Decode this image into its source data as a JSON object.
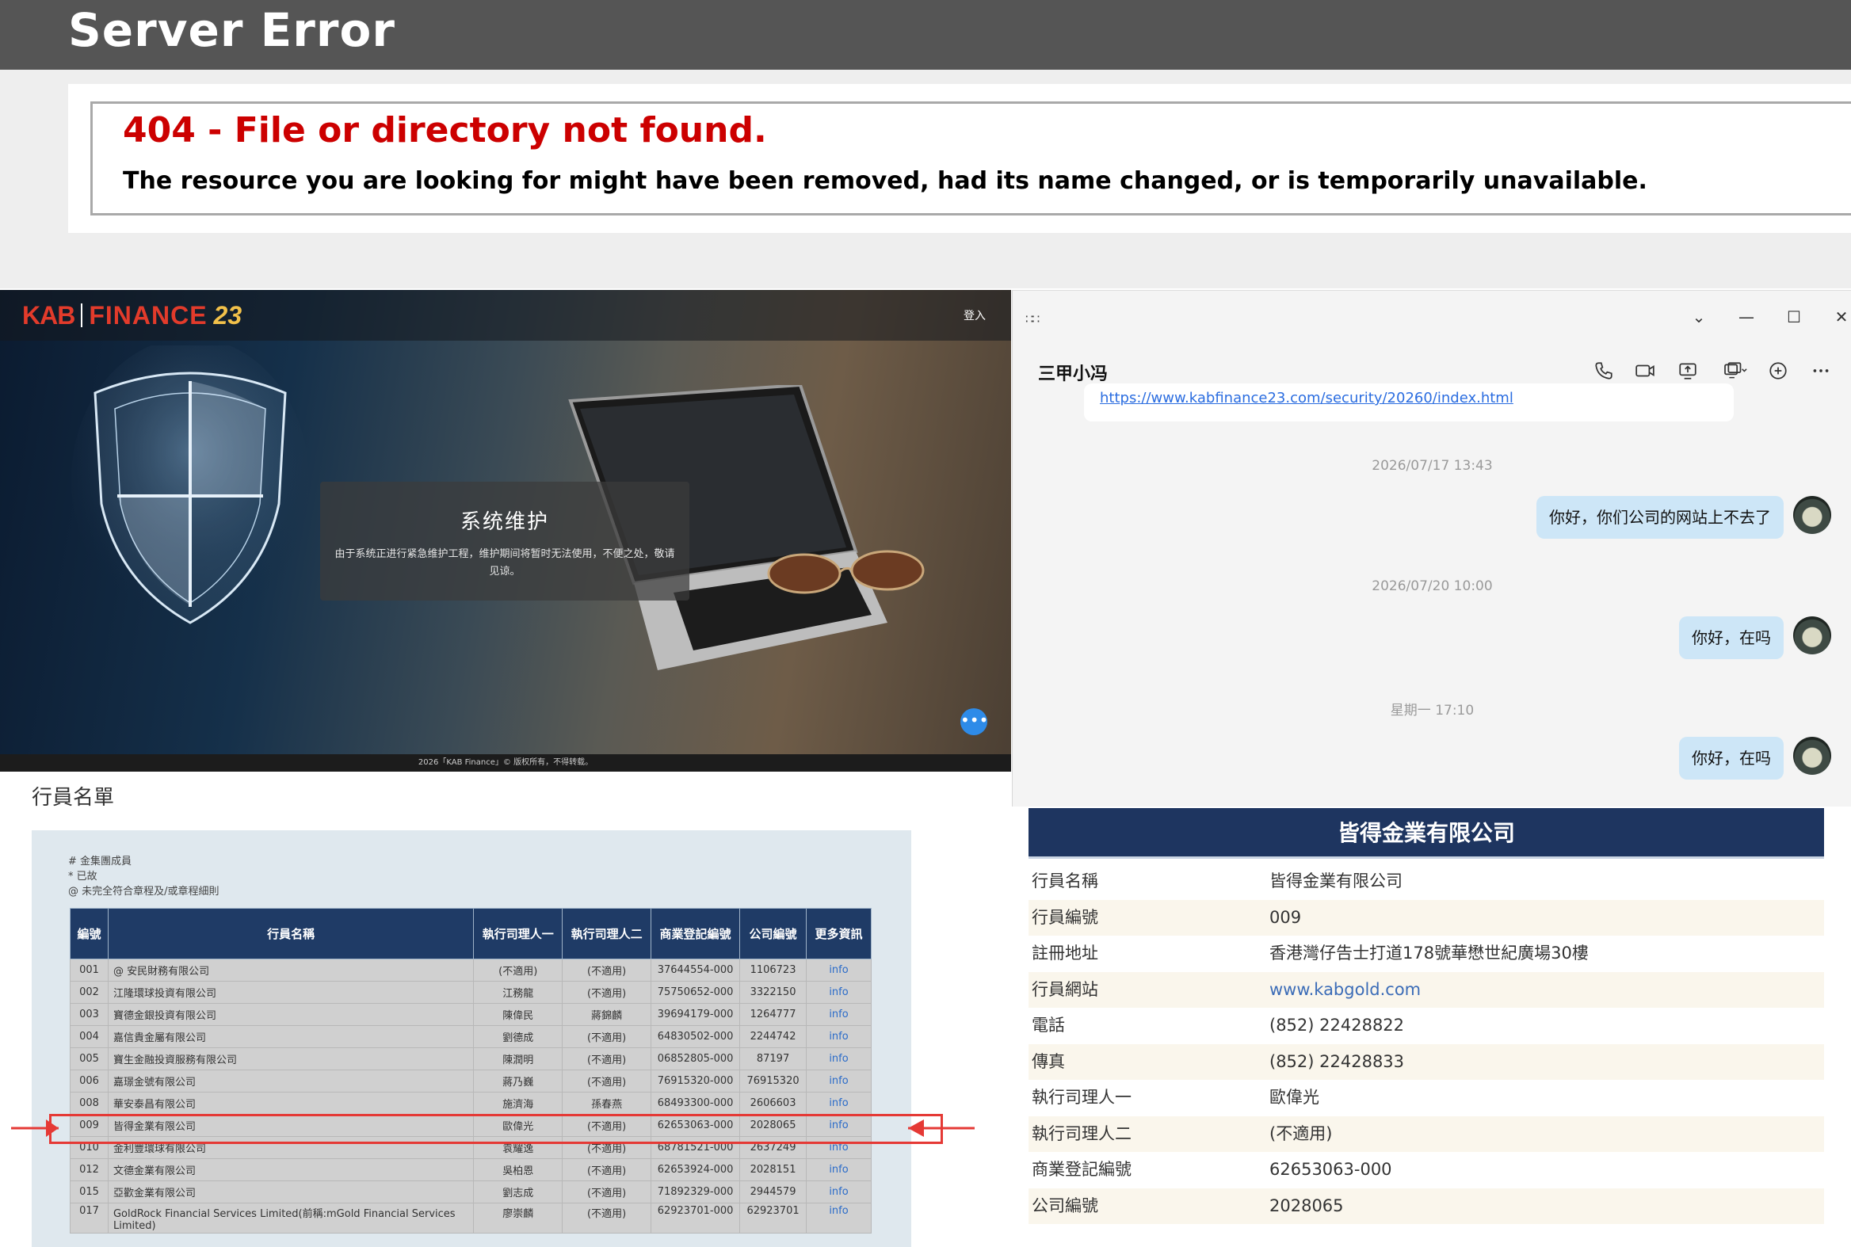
{
  "server_error": {
    "title": "Server Error",
    "code_line": "404 - File or directory not found.",
    "message": "The resource you are looking for might have been removed, had its name changed, or is temporarily unavailable."
  },
  "kab_site": {
    "logo_left": "KAB",
    "logo_mid": "FINANCE",
    "logo_num": "23",
    "login": "登入",
    "maintenance_title": "系统维护",
    "maintenance_text": "由于系统正进行紧急维护工程，维护期间将暂时无法使用，不便之处，敬请见谅。",
    "footer": "2026「KAB Finance」© 版权所有，不得转载。"
  },
  "chat": {
    "contact_name": "三甲小冯",
    "link_text": "https://www.kabfinance23.com/security/20260/index.html",
    "items": [
      {
        "type": "time",
        "text": "2026/07/17 13:43"
      },
      {
        "type": "msg",
        "text": "你好，你们公司的网站上不去了"
      },
      {
        "type": "time",
        "text": "2026/07/20 10:00"
      },
      {
        "type": "msg",
        "text": "你好，在吗"
      },
      {
        "type": "time",
        "text": "星期一 17:10"
      },
      {
        "type": "msg",
        "text": "你好，在吗"
      }
    ]
  },
  "member_list": {
    "title": "行員名單",
    "notes": [
      "# 金集團成員",
      "* 已故",
      "@ 未完全符合章程及/或章程細則"
    ],
    "headers": [
      "編號",
      "行員名稱",
      "執行司理人一",
      "執行司理人二",
      "商業登記編號",
      "公司編號",
      "更多資訊"
    ],
    "rows": [
      [
        "001",
        "@ 安民財務有限公司",
        "(不適用)",
        "(不適用)",
        "37644554-000",
        "1106723",
        "info"
      ],
      [
        "002",
        "江隆環球投資有限公司",
        "江務龍",
        "(不適用)",
        "75750652-000",
        "3322150",
        "info"
      ],
      [
        "003",
        "寶德金銀投資有限公司",
        "陳偉民",
        "蔣錦麟",
        "39694179-000",
        "1264777",
        "info"
      ],
      [
        "004",
        "嘉信貴金屬有限公司",
        "劉德成",
        "(不適用)",
        "64830502-000",
        "2244742",
        "info"
      ],
      [
        "005",
        "寶生金融投資服務有限公司",
        "陳潤明",
        "(不適用)",
        "06852805-000",
        "87197",
        "info"
      ],
      [
        "006",
        "嘉璟金號有限公司",
        "蔣乃巍",
        "(不適用)",
        "76915320-000",
        "76915320",
        "info"
      ],
      [
        "008",
        "華安泰昌有限公司",
        "施濟海",
        "孫春燕",
        "68493300-000",
        "2606603",
        "info"
      ],
      [
        "009",
        "皆得金業有限公司",
        "歐偉光",
        "(不適用)",
        "62653063-000",
        "2028065",
        "info"
      ],
      [
        "010",
        "金利豐環球有限公司",
        "袁耀逸",
        "(不適用)",
        "68781521-000",
        "2637249",
        "info"
      ],
      [
        "012",
        "文德金業有限公司",
        "吳柏恩",
        "(不適用)",
        "62653924-000",
        "2028151",
        "info"
      ],
      [
        "015",
        "亞歡金業有限公司",
        "劉志成",
        "(不適用)",
        "71892329-000",
        "2944579",
        "info"
      ],
      [
        "017",
        "GoldRock Financial Services Limited(前稱:mGold Financial Services Limited)",
        "廖崇麟",
        "(不適用)",
        "62923701-000",
        "62923701",
        "info"
      ]
    ]
  },
  "company": {
    "name": "皆得金業有限公司",
    "fields": [
      {
        "label": "行員名稱",
        "value": "皆得金業有限公司"
      },
      {
        "label": "行員編號",
        "value": "009"
      },
      {
        "label": "註冊地址",
        "value": "香港灣仔告士打道178號華懋世紀廣場30樓"
      },
      {
        "label": "行員網站",
        "value": "www.kabgold.com",
        "link": true
      },
      {
        "label": "電話",
        "value": "(852) 22428822"
      },
      {
        "label": "傳真",
        "value": "(852) 22428833"
      },
      {
        "label": "執行司理人一",
        "value": "歐偉光"
      },
      {
        "label": "執行司理人二",
        "value": "(不適用)"
      },
      {
        "label": "商業登記編號",
        "value": "62653063-000"
      },
      {
        "label": "公司編號",
        "value": "2028065"
      }
    ]
  },
  "colors": {
    "error_red": "#cc0000",
    "navy_header": "#1e3560",
    "highlight_red": "#e53935",
    "chat_bubble": "#cde6f7"
  }
}
